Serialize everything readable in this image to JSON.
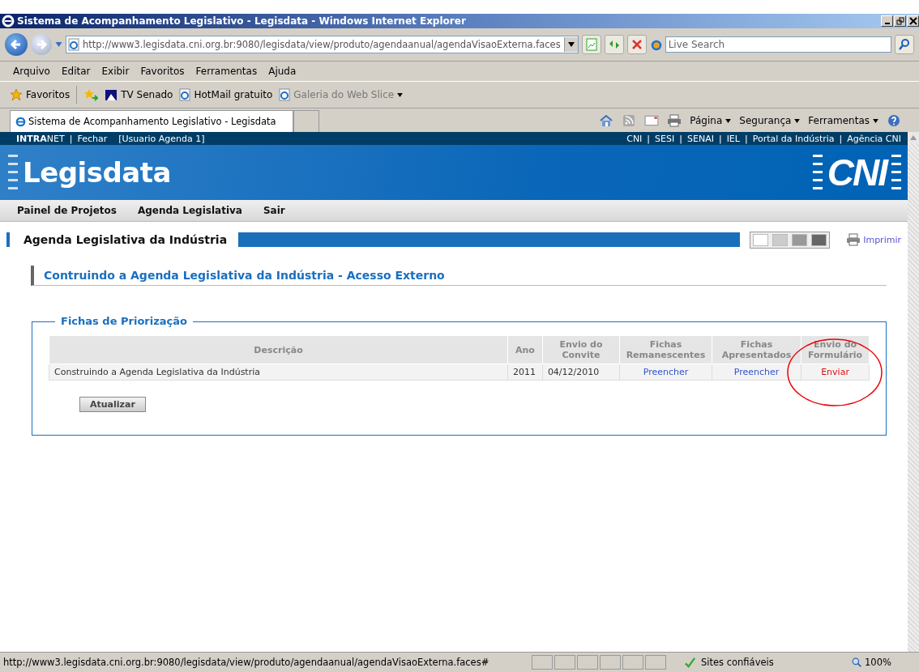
{
  "window": {
    "title": "Sistema de Acompanhamento Legislativo - Legisdata - Windows Internet Explorer"
  },
  "address_bar": {
    "url": "http://www3.legisdata.cni.org.br:9080/legisdata/view/produto/agendaanual/agendaVisaoExterna.faces"
  },
  "search": {
    "placeholder": "Live Search"
  },
  "menu": [
    "Arquivo",
    "Editar",
    "Exibir",
    "Favoritos",
    "Ferramentas",
    "Ajuda"
  ],
  "favorites_bar": {
    "label": "Favoritos",
    "links": [
      {
        "label": "TV Senado",
        "kind": "site"
      },
      {
        "label": "HotMail gratuito",
        "kind": "ie"
      },
      {
        "label": "Galeria do Web Slice",
        "kind": "slice"
      }
    ]
  },
  "tabs": [
    {
      "label": "Sistema de Acompanhamento Legislativo - Legisdata",
      "selected": true
    }
  ],
  "command_bar": [
    "Página",
    "Segurança",
    "Ferramentas"
  ],
  "page": {
    "separator": "|",
    "top_left": [
      "**INTRA**NET",
      "Fechar"
    ],
    "user": "[Usuario Agenda 1]",
    "top_right": [
      "CNI",
      "SESI",
      "SENAI",
      "IEL",
      "Portal da Indústria",
      "Agência CNI"
    ],
    "logo": "Legisdata",
    "brand": "CNI",
    "nav": [
      "Painel de Projetos",
      "Agenda Legislativa",
      "Sair"
    ],
    "heading": "Agenda Legislativa da Indústria",
    "swatches": [
      {
        "color": "#ffffff"
      },
      {
        "color": "#cccccc"
      },
      {
        "color": "#999999"
      },
      {
        "color": "#666666"
      }
    ],
    "print": "Imprimir",
    "subheading": "Contruindo a Agenda Legislativa da Indústria - Acesso Externo",
    "fieldset": {
      "legend": "Fichas de Priorização",
      "table": {
        "columns": [
          "Descrição",
          "Ano",
          "Envio do Convite",
          "Fichas Remanescentes",
          "Fichas Apresentados",
          "Envio do Formulário"
        ],
        "rows": [
          {
            "cells": [
              {
                "text": "Construindo a Agenda Legislativa da Indústria",
                "kind": "text"
              },
              {
                "text": "2011",
                "kind": "text"
              },
              {
                "text": "04/12/2010",
                "kind": "text"
              },
              {
                "text": "Preencher",
                "kind": "link"
              },
              {
                "text": "Preencher",
                "kind": "link"
              },
              {
                "text": "Enviar",
                "kind": "action"
              }
            ]
          }
        ]
      },
      "button": "Atualizar"
    }
  },
  "status_bar": {
    "url": "http://www3.legisdata.cni.org.br:9080/legisdata/view/produto/agendaanual/agendaVisaoExterna.faces#",
    "zone": "Sites confiáveis",
    "zoom": "100%"
  }
}
